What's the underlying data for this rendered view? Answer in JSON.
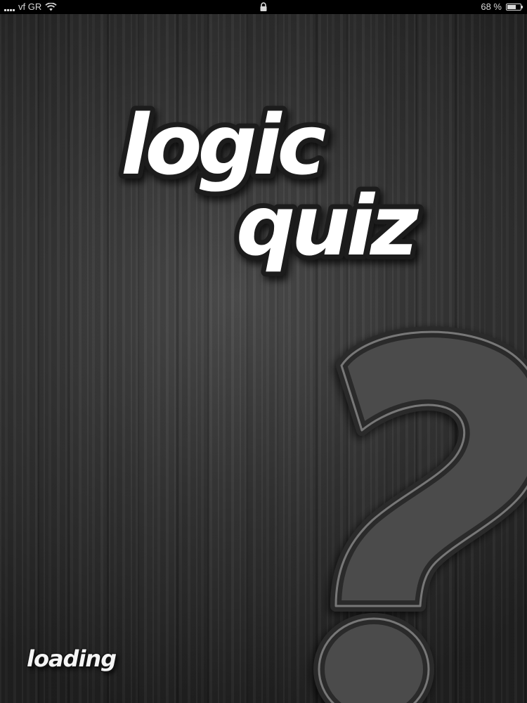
{
  "status_bar": {
    "carrier": "vf GR",
    "battery_text": "68 %",
    "battery_level": 0.68,
    "icons": [
      "signal-icon",
      "wifi-icon",
      "lock-icon",
      "battery-icon"
    ]
  },
  "splash": {
    "title_line1": "logic",
    "title_line2": "quiz",
    "loading_label": "loading",
    "decoration_icon": "question-mark-icon"
  },
  "colors": {
    "background": "#2e2e2e",
    "title_fill": "#ffffff",
    "title_outline": "#1a1a1a",
    "question_fill": "#4a4a4a",
    "question_outline": "#7a7a7a"
  }
}
